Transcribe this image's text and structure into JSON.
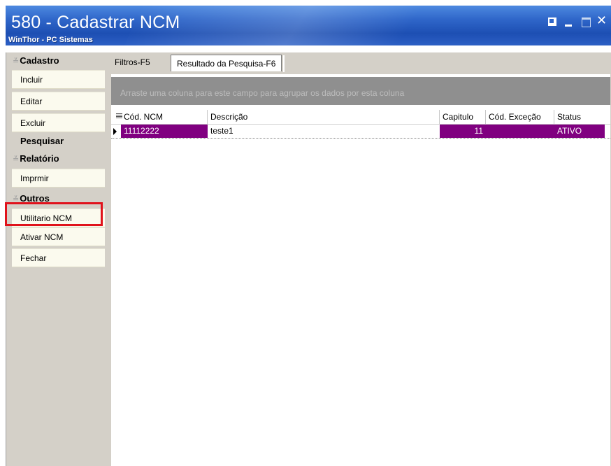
{
  "window": {
    "title": "580 - Cadastrar  NCM",
    "subtitle": "WinThor - PC Sistemas",
    "close_glyph": "✕"
  },
  "sidebar": {
    "groups": [
      {
        "label": "Cadastro",
        "items": [
          "Incluir",
          "Editar",
          "Excluir"
        ]
      },
      {
        "label": "Pesquisar"
      },
      {
        "label": "Relatório",
        "items": [
          "Imprmir"
        ]
      },
      {
        "label": "Outros",
        "items": [
          "Utilitario NCM",
          "Ativar NCM",
          "Fechar"
        ]
      }
    ],
    "chevron_glyph": "≚",
    "highlighted_item": "Utilitario NCM",
    "highlight_color": "#e0121b"
  },
  "tabs": [
    {
      "label": "Filtros-F5"
    },
    {
      "label": "Resultado da Pesquisa-F6",
      "active": true
    }
  ],
  "grid": {
    "group_hint": "Arraste uma coluna para este campo para agrupar os dados por esta coluna",
    "columns": [
      "Cód. NCM",
      "Descrição",
      "Capitulo",
      "Cód. Exceção",
      "Status"
    ],
    "rows": [
      [
        "11112222",
        "teste1",
        "11",
        "",
        "ATIVO"
      ]
    ],
    "selected_color": "#800080"
  },
  "colors": {
    "titlebar": "#2f66c9",
    "panel_bg": "#d4d0c8",
    "button_bg": "#fbfaee"
  }
}
